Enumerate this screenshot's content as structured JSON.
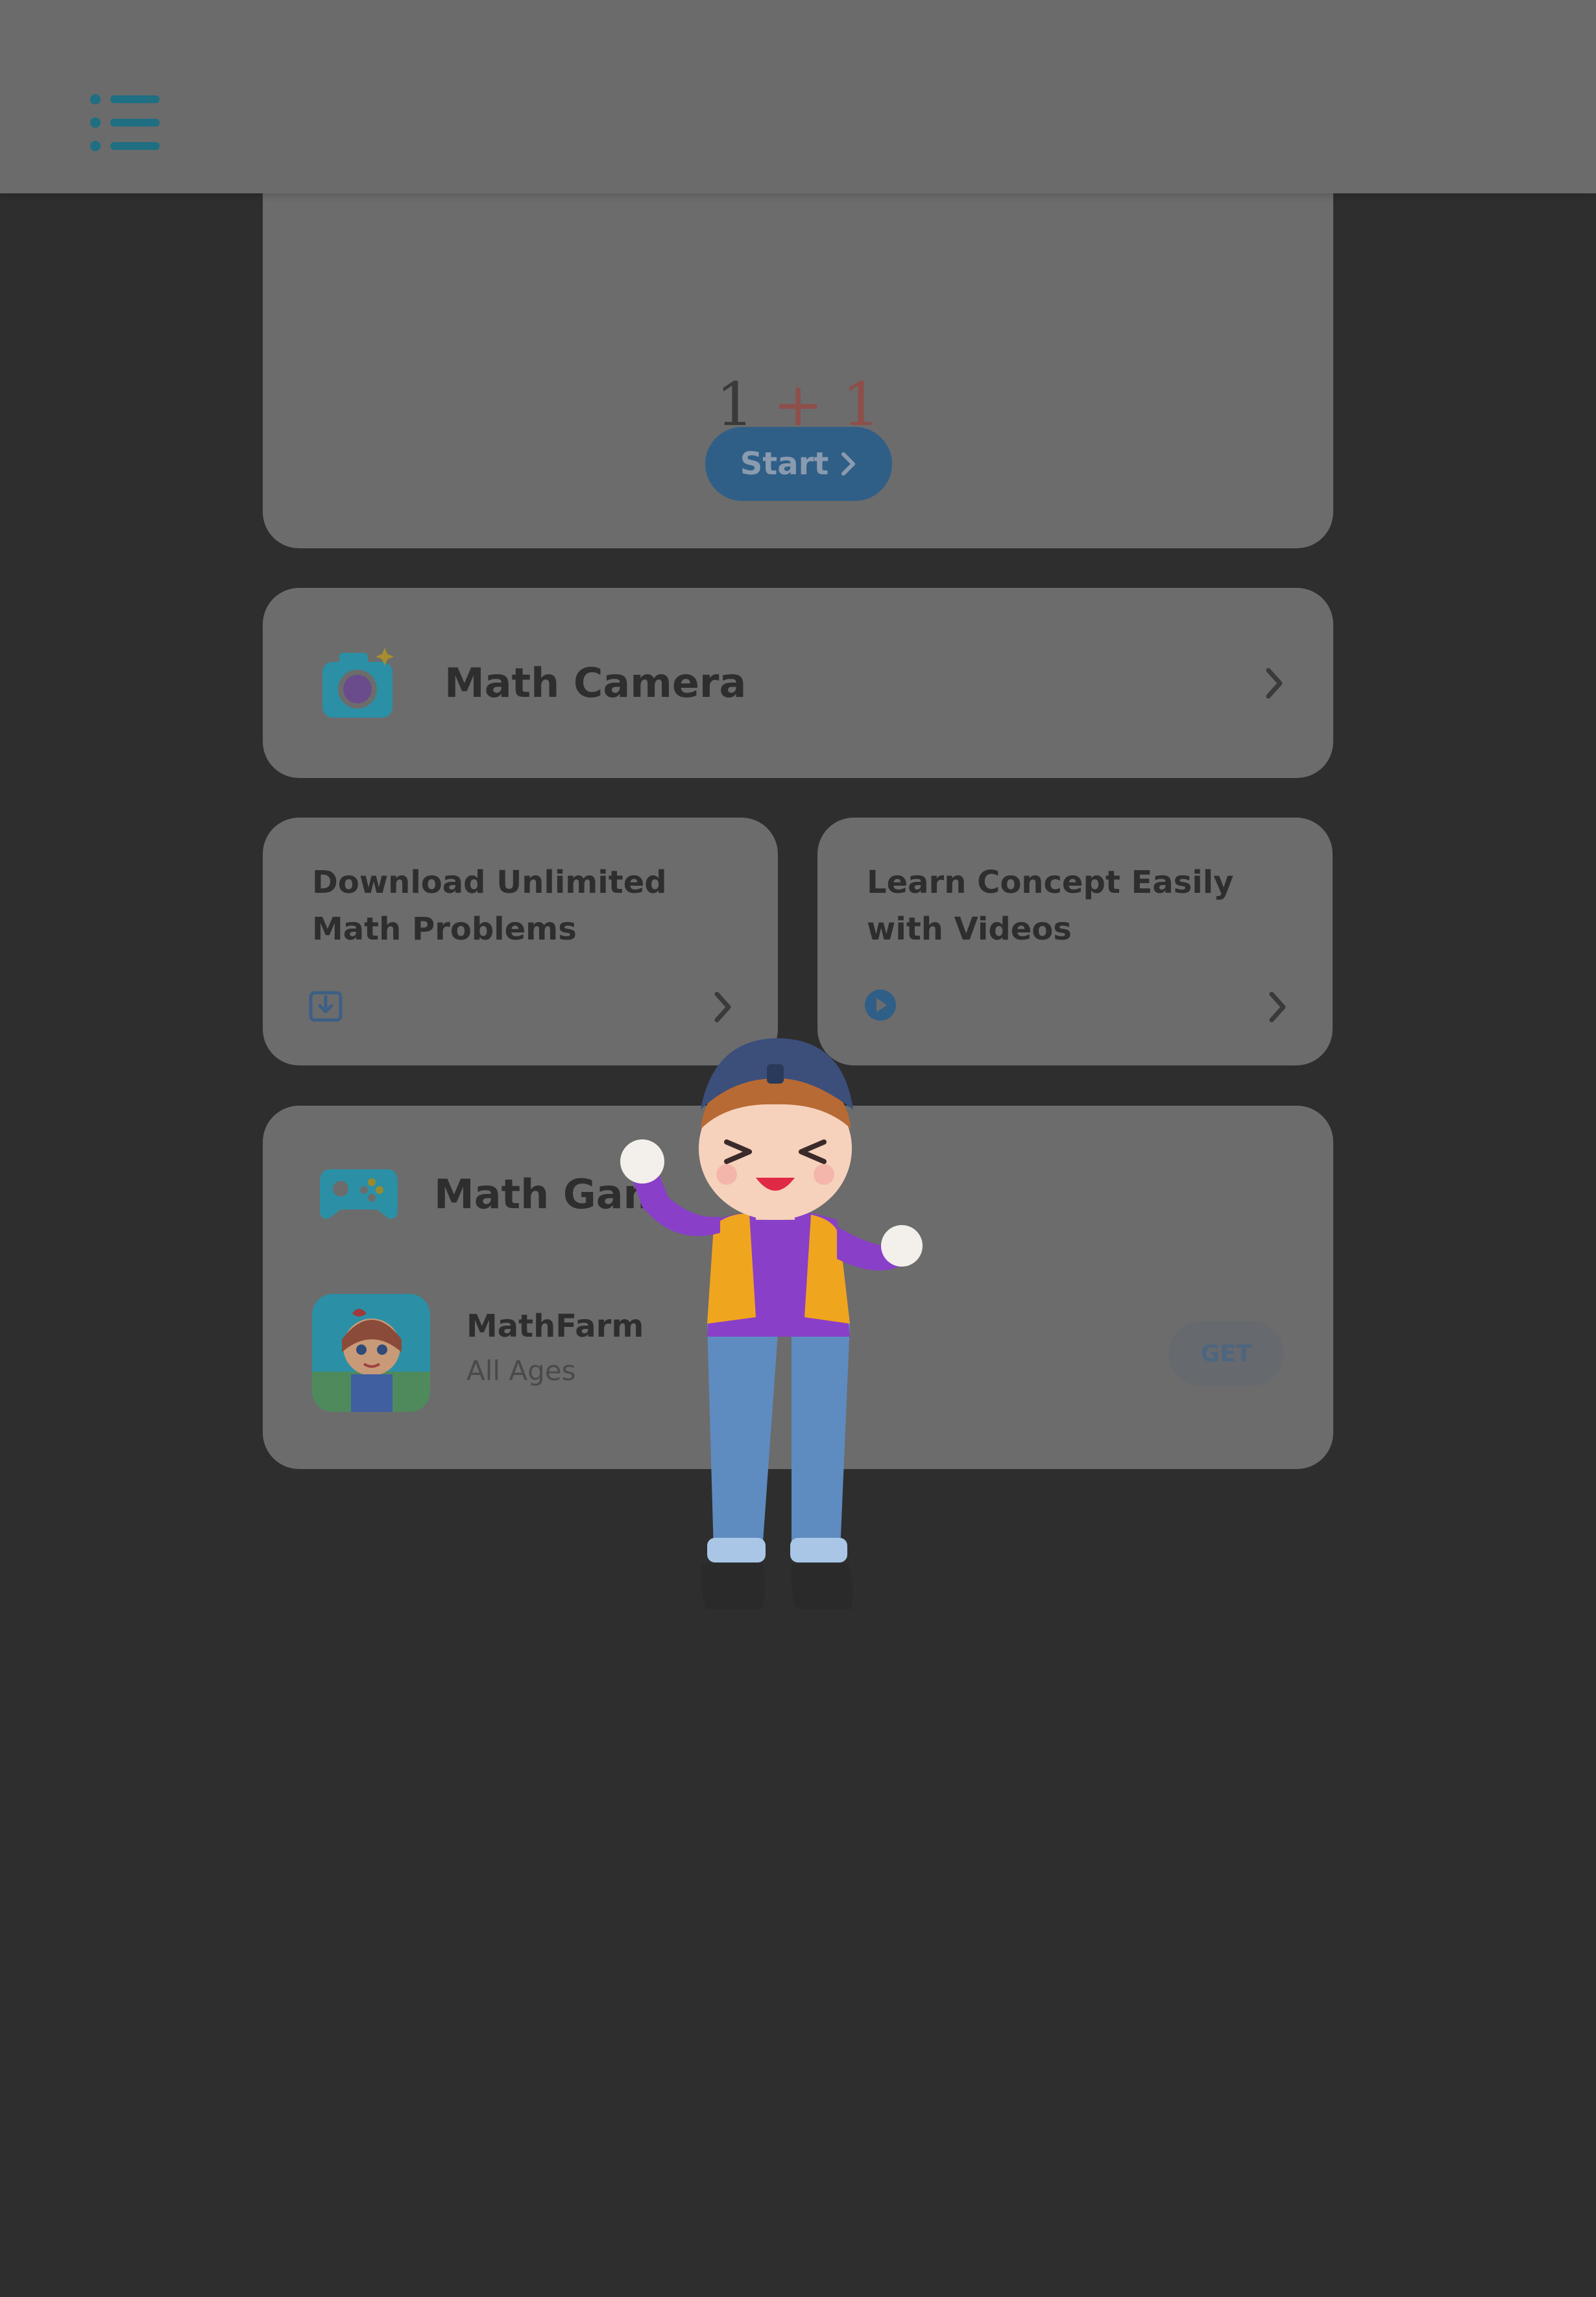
{
  "header": {
    "menu_icon": "list-menu-icon"
  },
  "calculator": {
    "expression": {
      "left": "1",
      "operator": "+",
      "right": "1"
    },
    "start_label": "Start"
  },
  "math_camera": {
    "title": "Math Camera",
    "icon": "camera-icon"
  },
  "download_card": {
    "title": "Download Unlimited Math Problems",
    "icon": "download-icon"
  },
  "videos_card": {
    "title": "Learn Concept Easily with Videos",
    "icon": "play-icon"
  },
  "math_games": {
    "title": "Math Gam",
    "icon": "gamepad-icon",
    "app": {
      "name": "MathFarm",
      "age": "All Ages",
      "get_label": "GET"
    }
  },
  "mascot": {
    "icon": "boy-mascot-illustration"
  },
  "colors": {
    "accent_teal": "#2b8fa6",
    "accent_blue": "#2f5f86",
    "overlay_dark": "#2e2e2e",
    "card_bg": "#6c6c6c"
  }
}
